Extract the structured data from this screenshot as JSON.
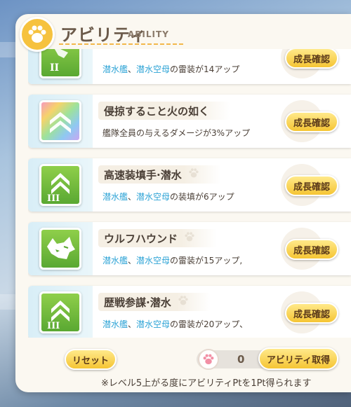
{
  "header": {
    "title": "アビリティ",
    "subtitle": "ABILITY",
    "icon": "paw-icon"
  },
  "abilities": [
    {
      "name": "",
      "icon": "torpedo-rank-2-icon",
      "rank": "II",
      "desc_hl1": "潜水艦",
      "desc_sep": "、",
      "desc_hl2": "潜水空母",
      "desc_rest": "の雷装が14アップ",
      "button": "成長確認"
    },
    {
      "name": "侵掠すること火の如く",
      "icon": "chevron-rainbow-icon",
      "rank": "",
      "desc_plain": "艦隊全員の与えるダメージが3%アップ",
      "button": "成長確認"
    },
    {
      "name": "高速装填手·潜水",
      "icon": "chevron-rank-3-icon",
      "rank": "III",
      "desc_hl1": "潜水艦",
      "desc_sep": "、",
      "desc_hl2": "潜水空母",
      "desc_rest": "の装填が6アップ",
      "button": "成長確認"
    },
    {
      "name": "ウルフハウンド",
      "icon": "wolf-head-icon",
      "rank": "",
      "desc_hl1": "潜水艦",
      "desc_sep": "、",
      "desc_hl2": "潜水空母",
      "desc_rest": "の雷装が15アップ,",
      "button": "成長確認"
    },
    {
      "name": "歴戦参謀·潜水",
      "icon": "chevron-rank-3-icon",
      "rank": "III",
      "desc_hl1": "潜水艦",
      "desc_sep": "、",
      "desc_hl2": "潜水空母",
      "desc_rest": "の雷装が20アップ、",
      "button": "成長確認"
    }
  ],
  "footer": {
    "reset_label": "リセット",
    "points_value": "0",
    "acquire_label": "アビリティ取得",
    "note": "※レベル5上がる度にアビリティPtを1Pt得られます"
  },
  "colors": {
    "accent_yellow": "#f5c534",
    "highlight_blue": "#2fa4d6",
    "icon_green": "#5aa832"
  }
}
